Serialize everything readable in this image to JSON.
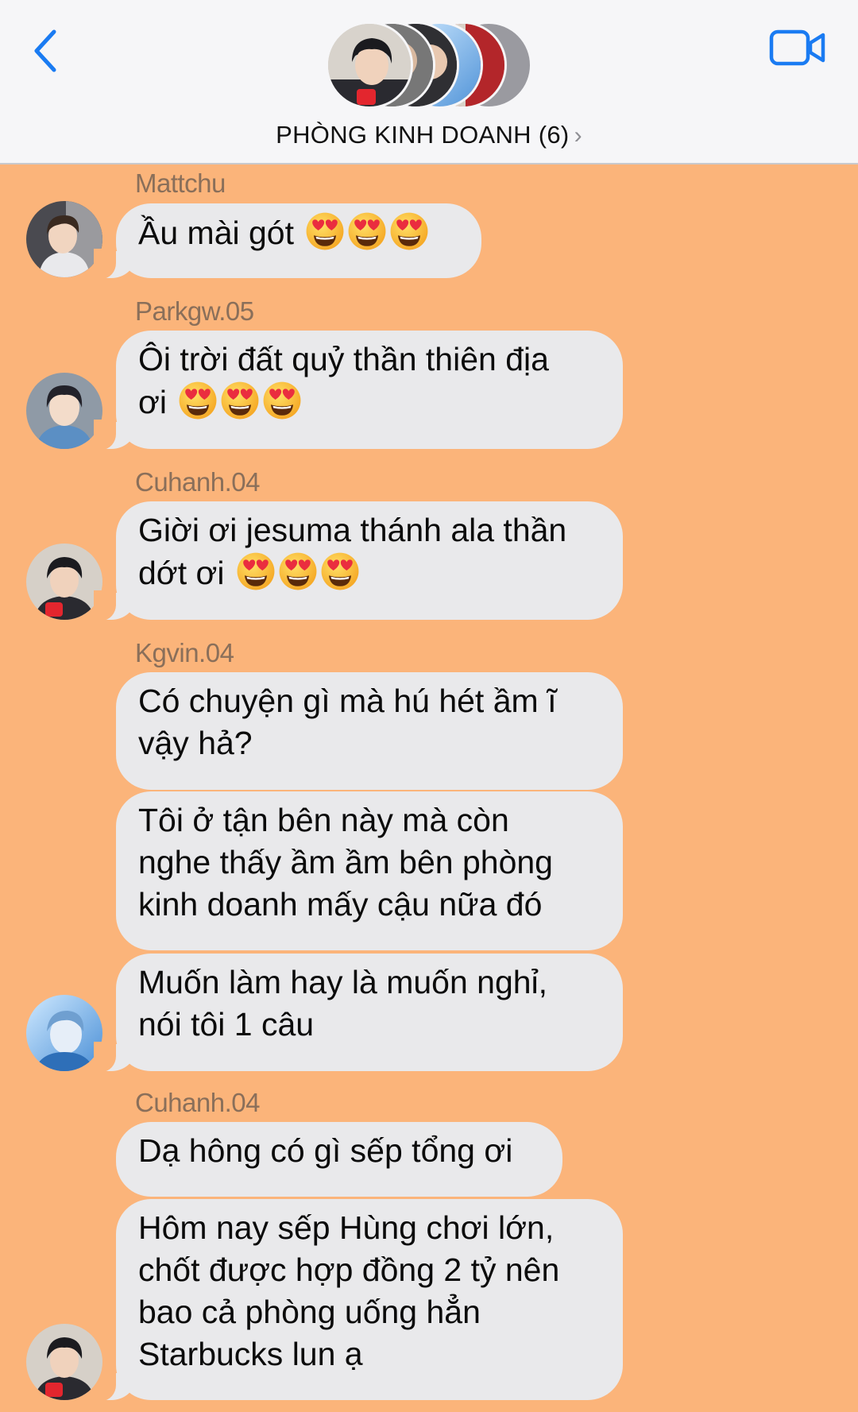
{
  "header": {
    "group_title": "PHÒNG KINH DOANH (6)",
    "chevron_glyph": "›",
    "back_icon": "chevron-left-icon",
    "video_icon": "video-camera-icon",
    "accent_color": "#1a7bf2",
    "chat_background": "#fbb47a",
    "bubble_color": "#e9e9eb"
  },
  "messages": [
    {
      "sender": "Mattchu",
      "text": "Ầu mài gót",
      "emoji": "heart-eyes-emoji",
      "emoji_count": 3
    },
    {
      "sender": "Parkgw.05",
      "lines": [
        "Ôi trời đất quỷ thần thiên địa",
        "ơi"
      ],
      "emoji": "heart-eyes-emoji",
      "emoji_count": 3
    },
    {
      "sender": "Cuhanh.04",
      "lines": [
        "Giời ơi jesuma thánh ala thần",
        "dớt ơi"
      ],
      "emoji": "heart-eyes-emoji",
      "emoji_count": 3
    },
    {
      "sender": "Kgvin.04",
      "lines": [
        "Có chuyện gì mà hú hét ầm ĩ",
        "vậy hả?"
      ]
    },
    {
      "lines": [
        "Tôi ở tận bên này mà còn",
        "nghe thấy ầm ầm bên phòng",
        "kinh doanh mấy cậu nữa đó"
      ]
    },
    {
      "lines": [
        "Muốn làm hay là muốn nghỉ,",
        "nói tôi 1 câu"
      ]
    },
    {
      "sender": "Cuhanh.04",
      "text": "Dạ hông có gì sếp tổng ơi"
    },
    {
      "lines": [
        "Hôm nay sếp Hùng chơi lớn,",
        "chốt được hợp đồng 2 tỷ nên",
        "bao cả phòng uống hẳn",
        "Starbucks lun ạ"
      ]
    }
  ]
}
